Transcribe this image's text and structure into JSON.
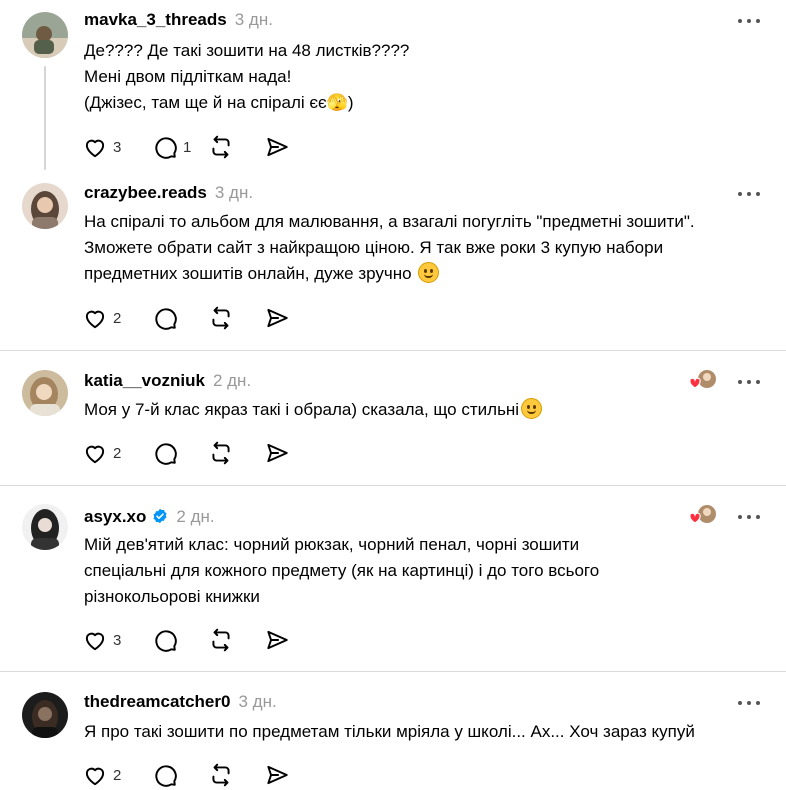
{
  "posts": [
    {
      "username": "mavka_3_threads",
      "time": "3 дн.",
      "lines": [
        "Де???? Де такі зошити на 48 листків????",
        "Мені двом підліткам нада!",
        "(Джізес, там ще й на спіралі єє🫣)"
      ],
      "likes": "3",
      "replies": "1",
      "avatar_colors": [
        "#8a9a88",
        "#c9b8a2"
      ]
    },
    {
      "username": "crazybee.reads",
      "time": "3 дн.",
      "lines": [
        "На спіралі то альбом для малювання, а взагалі погугліть \"предметні зошити\".",
        "Зможете обрати сайт з найкращою ціною. Я так вже роки 3 купую набори",
        "предметних зошитів онлайн, дуже зручно"
      ],
      "emoji": "smiling-face",
      "likes": "2",
      "replies": "",
      "avatar_colors": [
        "#6b5a4e",
        "#e0cfc0"
      ]
    },
    {
      "username": "katia__vozniuk",
      "time": "2 дн.",
      "lines": [
        "Моя у 7-й клас якраз такі і обрала) сказала, що стильні"
      ],
      "emoji": "smiling-face",
      "likes": "2",
      "replies": "",
      "liked_by_author": true,
      "avatar_colors": [
        "#a08a6e",
        "#e7d4b6"
      ]
    },
    {
      "username": "asyx.xo",
      "verified": true,
      "time": "2 дн.",
      "lines": [
        "Мій дев'ятий клас: чорний рюкзак, чорний пенал, чорні зошити",
        "спеціальні для кожного предмету (як на картинці) і до того всього",
        "різнокольорові книжки"
      ],
      "likes": "3",
      "replies": "",
      "liked_by_author": true,
      "avatar_colors": [
        "#2a2a2a",
        "#eeeeee"
      ]
    },
    {
      "username": "thedreamcatcher0",
      "time": "3 дн.",
      "lines": [
        "Я про такі зошити по предметам тільки мріяла у школі... Ах... Хоч зараз купуй"
      ],
      "likes": "2",
      "replies": "",
      "avatar_colors": [
        "#1e1e1e",
        "#6b5848"
      ]
    }
  ],
  "icons": {
    "like": "heart-icon",
    "reply": "comment-icon",
    "repost": "repost-icon",
    "share": "send-icon",
    "more": "more-icon",
    "verified": "verified-icon"
  },
  "colors": {
    "verified": "#0095f6",
    "heart_badge": "#ff3040",
    "muted": "#999999",
    "divider": "#dbdbdb"
  }
}
